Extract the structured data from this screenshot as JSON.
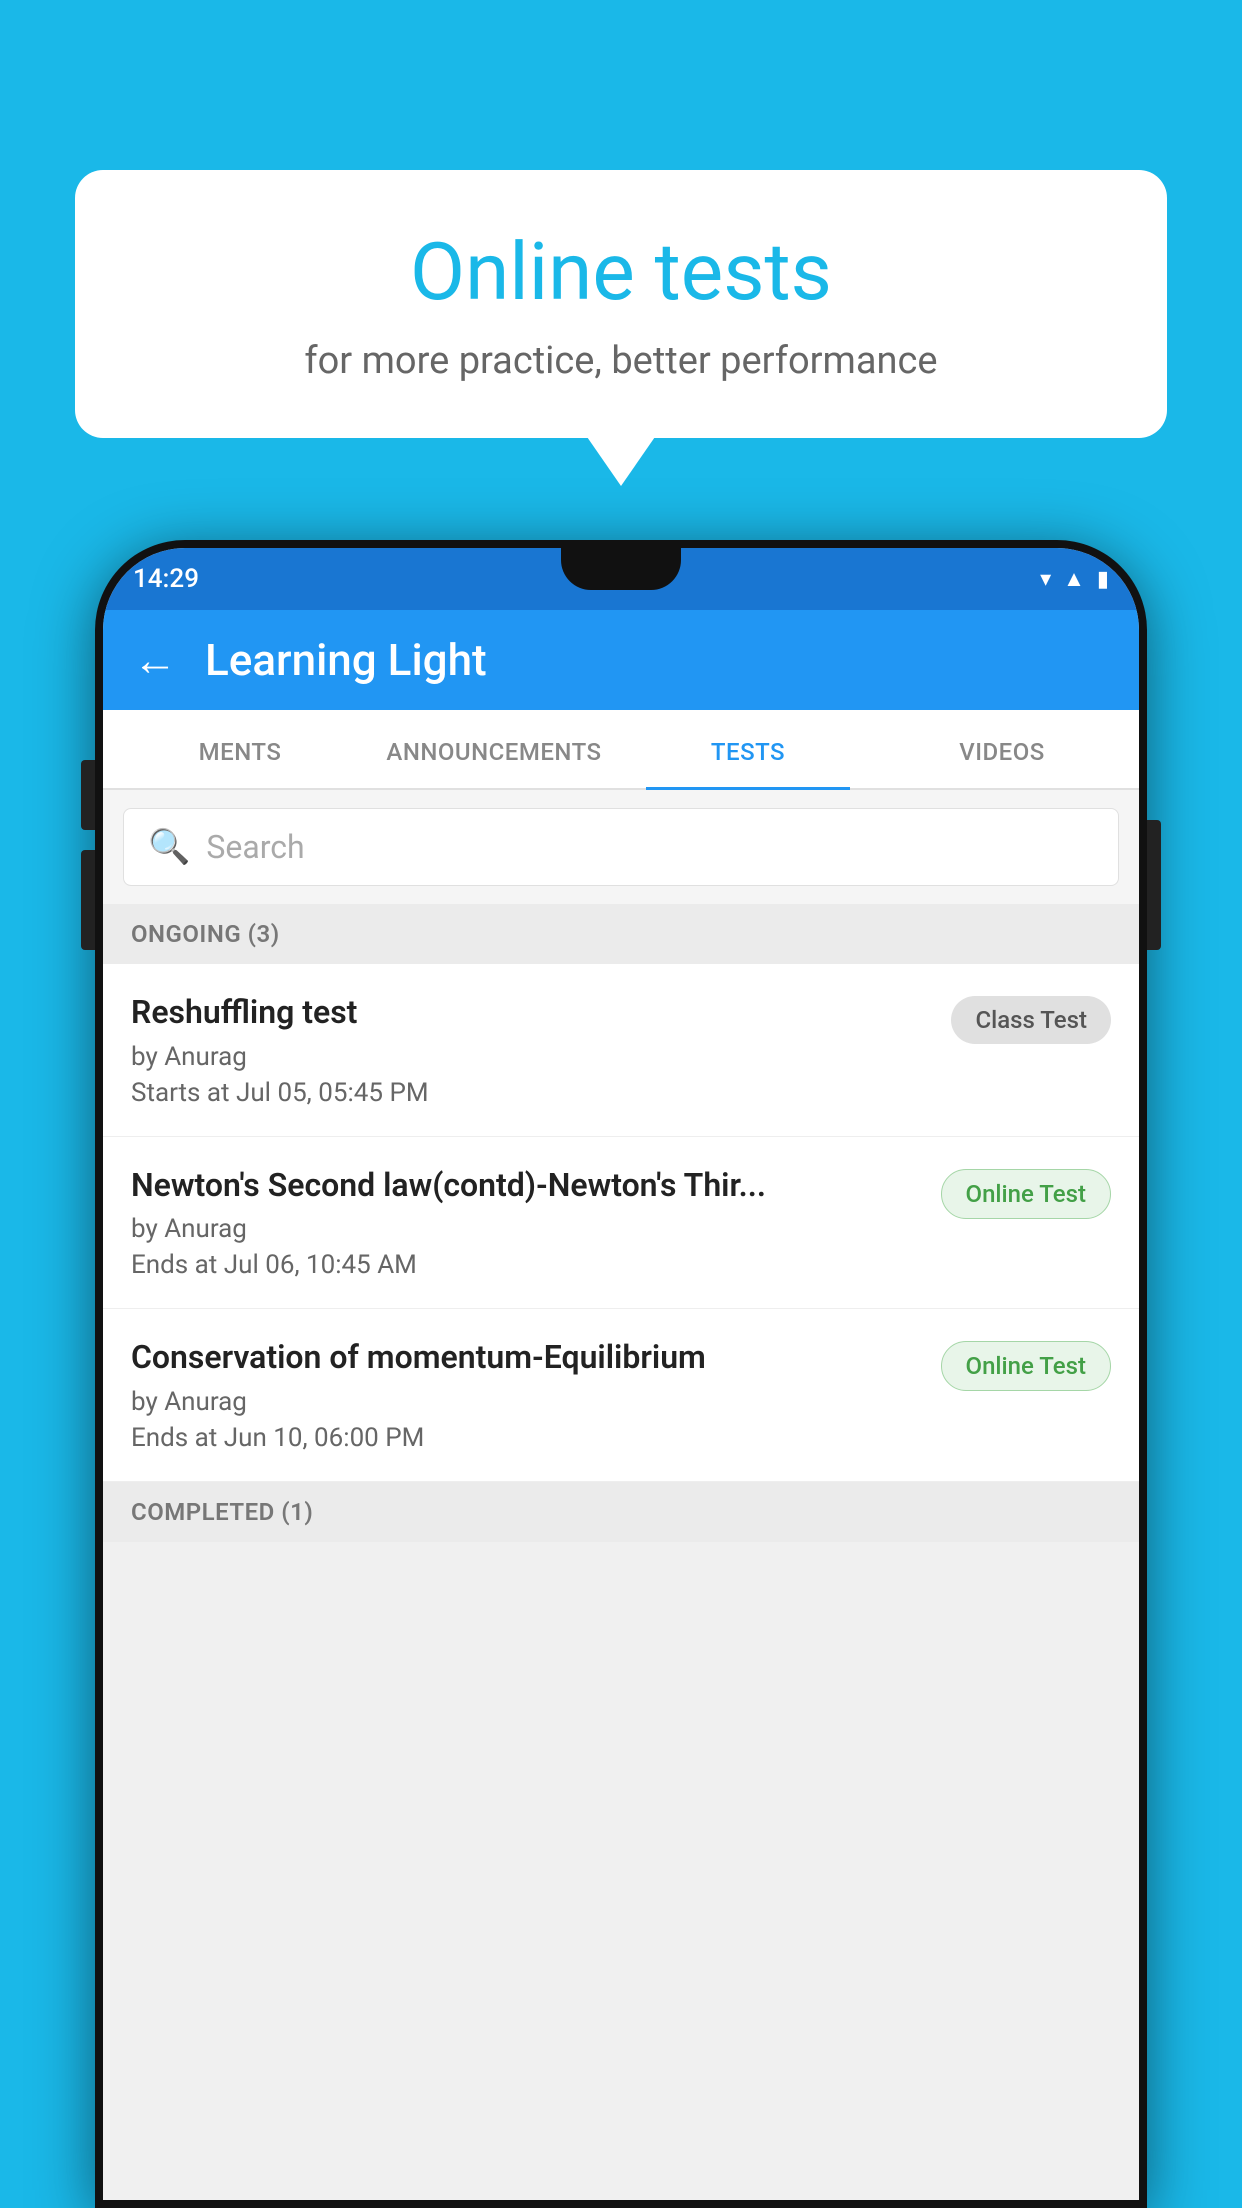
{
  "background_color": "#1ab8e8",
  "speech_bubble": {
    "title": "Online tests",
    "subtitle": "for more practice, better performance"
  },
  "status_bar": {
    "time": "14:29",
    "icons": [
      "▾▴",
      "▴",
      "▮"
    ]
  },
  "app_bar": {
    "title": "Learning Light",
    "back_label": "←"
  },
  "tabs": [
    {
      "label": "MENTS",
      "active": false
    },
    {
      "label": "ANNOUNCEMENTS",
      "active": false
    },
    {
      "label": "TESTS",
      "active": true
    },
    {
      "label": "VIDEOS",
      "active": false
    }
  ],
  "search": {
    "placeholder": "Search"
  },
  "sections": [
    {
      "title": "ONGOING (3)",
      "items": [
        {
          "name": "Reshuffling test",
          "author": "by Anurag",
          "date": "Starts at  Jul 05, 05:45 PM",
          "badge": "Class Test",
          "badge_type": "class"
        },
        {
          "name": "Newton's Second law(contd)-Newton's Thir...",
          "author": "by Anurag",
          "date": "Ends at  Jul 06, 10:45 AM",
          "badge": "Online Test",
          "badge_type": "online"
        },
        {
          "name": "Conservation of momentum-Equilibrium",
          "author": "by Anurag",
          "date": "Ends at  Jun 10, 06:00 PM",
          "badge": "Online Test",
          "badge_type": "online"
        }
      ]
    }
  ],
  "completed_section": {
    "title": "COMPLETED (1)"
  }
}
